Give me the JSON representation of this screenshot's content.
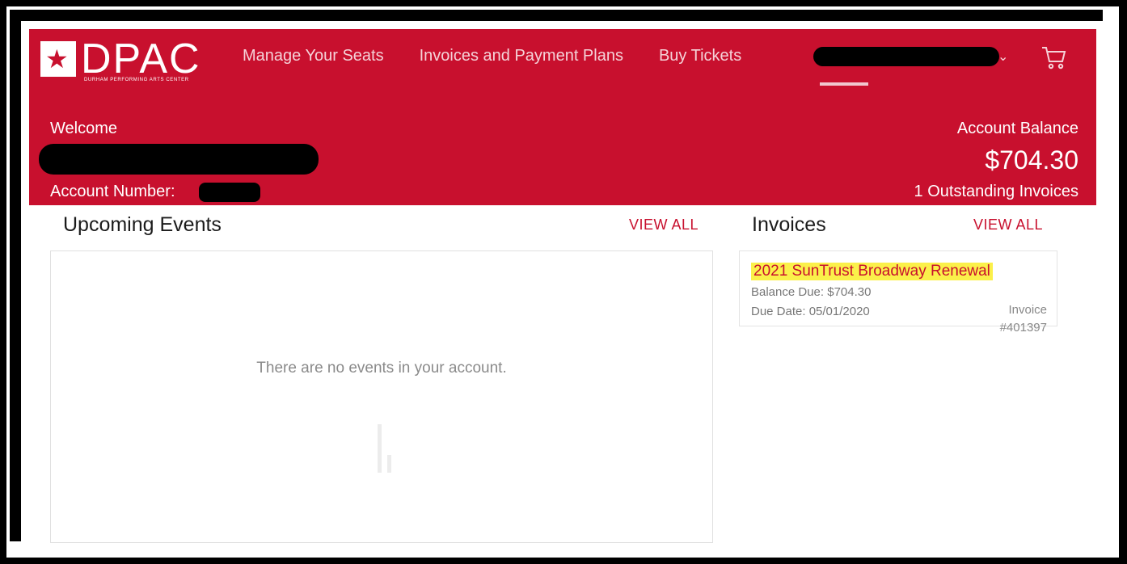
{
  "brand": {
    "logo_text": "DPAC",
    "logo_subtitle": "DURHAM PERFORMING ARTS CENTER",
    "logo_star": "★"
  },
  "nav": {
    "links": [
      "Manage Your Seats",
      "Invoices and Payment Plans",
      "Buy Tickets"
    ],
    "user_chevron": "⌄",
    "cart_icon": "cart-icon"
  },
  "welcome": {
    "label": "Welcome",
    "account_number_label": "Account Number:",
    "balance_label": "Account Balance",
    "balance_value": "$704.30",
    "outstanding": "1 Outstanding Invoices"
  },
  "events": {
    "title": "Upcoming Events",
    "view_all": "VIEW ALL",
    "empty_message": "There are no events in your account."
  },
  "invoices": {
    "title": "Invoices",
    "view_all": "VIEW ALL",
    "items": [
      {
        "name": "2021 SunTrust Broadway Renewal",
        "balance_due": "Balance Due: $704.30",
        "due_date": "Due Date: 05/01/2020",
        "invoice_label": "Invoice",
        "invoice_number": "#401397"
      }
    ]
  },
  "colors": {
    "brand_red": "#c8102e",
    "highlight": "#fbf04a"
  }
}
